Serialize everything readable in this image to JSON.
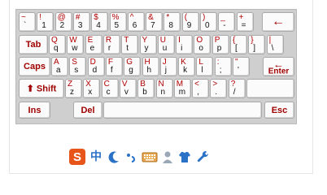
{
  "row1": [
    {
      "u": "~",
      "l": "`"
    },
    {
      "u": "!",
      "l": "1"
    },
    {
      "u": "@",
      "l": "2"
    },
    {
      "u": "#",
      "l": "3"
    },
    {
      "u": "$",
      "l": "4"
    },
    {
      "u": "%",
      "l": "5"
    },
    {
      "u": "^",
      "l": "6"
    },
    {
      "u": "&",
      "l": "7"
    },
    {
      "u": "*",
      "l": "8"
    },
    {
      "u": "(",
      "l": "9"
    },
    {
      "u": ")",
      "l": "0"
    },
    {
      "u": "_",
      "l": "-"
    },
    {
      "u": "+",
      "l": "="
    }
  ],
  "row2": [
    {
      "u": "Q",
      "l": "q"
    },
    {
      "u": "W",
      "l": "w"
    },
    {
      "u": "E",
      "l": "e"
    },
    {
      "u": "R",
      "l": "r"
    },
    {
      "u": "T",
      "l": "t"
    },
    {
      "u": "Y",
      "l": "y"
    },
    {
      "u": "U",
      "l": "u"
    },
    {
      "u": "I",
      "l": "i"
    },
    {
      "u": "O",
      "l": "o"
    },
    {
      "u": "P",
      "l": "p"
    },
    {
      "u": "{",
      "l": "["
    },
    {
      "u": "}",
      "l": "]"
    },
    {
      "u": "|",
      "l": "\\"
    }
  ],
  "row2_right": [
    "T",
    "Y",
    "U",
    "I",
    "O",
    "P",
    "[",
    "]",
    "\\"
  ],
  "row3": [
    {
      "u": "A",
      "l": "a"
    },
    {
      "u": "S",
      "l": "s"
    },
    {
      "u": "D",
      "l": "d"
    },
    {
      "u": "F",
      "l": "f"
    },
    {
      "u": "G",
      "l": "g"
    },
    {
      "u": "H",
      "l": "h"
    },
    {
      "u": "J",
      "l": "j"
    },
    {
      "u": "K",
      "l": "k"
    },
    {
      "u": "L",
      "l": "l"
    },
    {
      "u": ":",
      "l": ";"
    },
    {
      "u": "\"",
      "l": "'"
    }
  ],
  "row4": [
    {
      "u": "Z",
      "l": "z"
    },
    {
      "u": "X",
      "l": "x"
    },
    {
      "u": "C",
      "l": "c"
    },
    {
      "u": "V",
      "l": "v"
    },
    {
      "u": "B",
      "l": "b"
    },
    {
      "u": "N",
      "l": "n"
    },
    {
      "u": "M",
      "l": "m"
    },
    {
      "u": "<",
      "l": ","
    },
    {
      "u": ">",
      "l": "."
    },
    {
      "u": "?",
      "l": "/"
    }
  ],
  "keys": {
    "backspace": "←",
    "tab": "Tab",
    "caps": "Caps",
    "enter_arrow": "←",
    "enter": "Enter",
    "shift_arrow": "⬆",
    "shift": "Shift",
    "ins": "Ins",
    "del": "Del",
    "esc": "Esc"
  },
  "toolbar": {
    "logo": "S",
    "mode": "中",
    "icons": [
      "moon-icon",
      "punctuation-icon",
      "keyboard-icon",
      "user-icon",
      "skin-icon",
      "wrench-icon"
    ]
  },
  "colors": {
    "shifted": "#b00000",
    "function": "#a00000",
    "board": "#cfcfcf",
    "logo": "#e8551a",
    "toolbar_blue": "#2a72c7"
  }
}
